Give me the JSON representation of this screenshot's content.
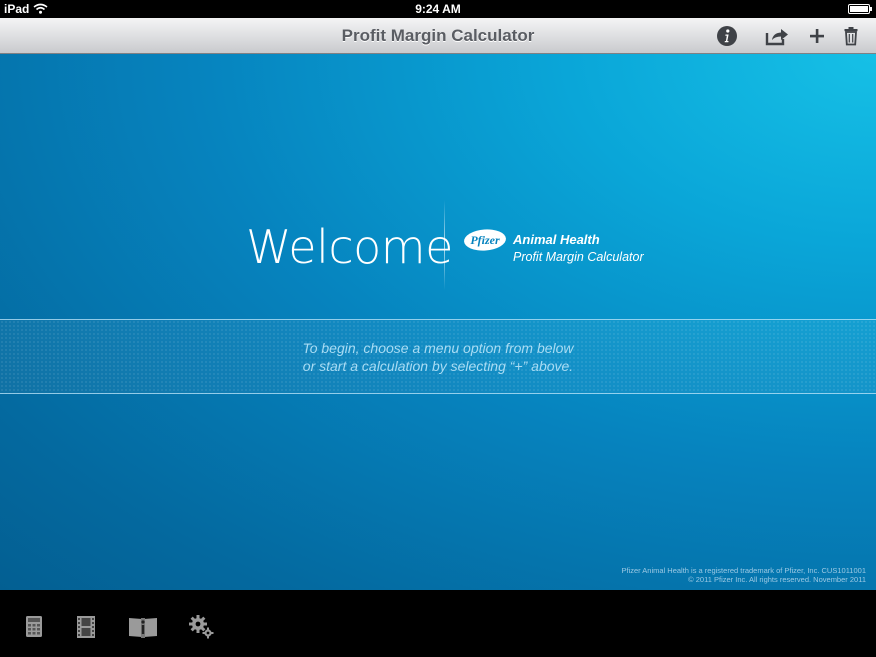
{
  "status_bar": {
    "carrier": "iPad",
    "time": "9:24 AM"
  },
  "nav_bar": {
    "title": "Profit Margin Calculator",
    "buttons": [
      "info-icon",
      "share-icon",
      "plus-icon",
      "trash-icon"
    ]
  },
  "welcome": {
    "heading": "Welcome",
    "logo_text": "Pfizer",
    "brand": "Animal Health",
    "product": "Profit Margin Calculator"
  },
  "instructions": {
    "line1": "To begin, choose a menu option from below",
    "line2": "or start a calculation by selecting “+” above."
  },
  "legal": {
    "line1": "Pfizer Animal Health is a registered trademark of Pfizer, Inc.  CUS1011001",
    "line2": "© 2011 Pfizer Inc. All rights reserved.  November 2011"
  },
  "toolbar": {
    "items": [
      "calculator-icon",
      "film-icon",
      "info-book-icon",
      "settings-gears-icon"
    ]
  },
  "colors": {
    "accent_blue": "#0683be",
    "nav_title": "#5a5d63"
  }
}
